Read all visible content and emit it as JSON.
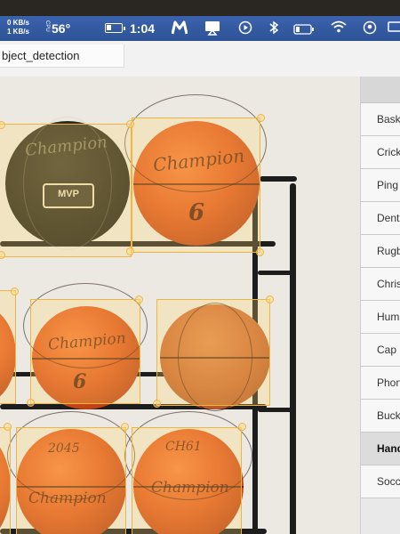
{
  "menubar": {
    "net_up": "0 KB/s",
    "net_down": "1 KB/s",
    "temp_vertical": "CPU",
    "temperature": "56°",
    "clock": "1:04",
    "icons": [
      "battery-icon",
      "app-m-icon",
      "airplay-icon",
      "play-icon",
      "bluetooth-icon",
      "battery-icon",
      "wifi-icon",
      "user-icon",
      "cast-icon"
    ]
  },
  "window": {
    "title": "bject_detection"
  },
  "labels": [
    {
      "text": "Basketball",
      "selected": false
    },
    {
      "text": "Cricket ball",
      "selected": false
    },
    {
      "text": "Ping pong ball",
      "selected": false
    },
    {
      "text": "Dental floss",
      "selected": false
    },
    {
      "text": "Rugby ball",
      "selected": false
    },
    {
      "text": "Christmas tree",
      "selected": false
    },
    {
      "text": "Human",
      "selected": false
    },
    {
      "text": "Cap",
      "selected": false
    },
    {
      "text": "Phone",
      "selected": false
    },
    {
      "text": "Bucket",
      "selected": false
    },
    {
      "text": "Handshake",
      "selected": true
    },
    {
      "text": "Soccer ball",
      "selected": false
    }
  ],
  "balls": [
    {
      "logo": "Champion",
      "number": "",
      "badge": "MVP"
    },
    {
      "logo": "Champion",
      "number": "6",
      "badge": ""
    },
    {
      "logo": "Champion",
      "number": "6",
      "badge": ""
    },
    {
      "logo": "",
      "number": "",
      "badge": ""
    },
    {
      "logo": "Champion",
      "number": "",
      "badge": "",
      "top_text": "2045"
    },
    {
      "logo": "Champion",
      "number": "",
      "badge": "",
      "top_text": "CH61"
    }
  ],
  "colors": {
    "bbox": "#f2b440",
    "menubar": "#2d5296"
  }
}
